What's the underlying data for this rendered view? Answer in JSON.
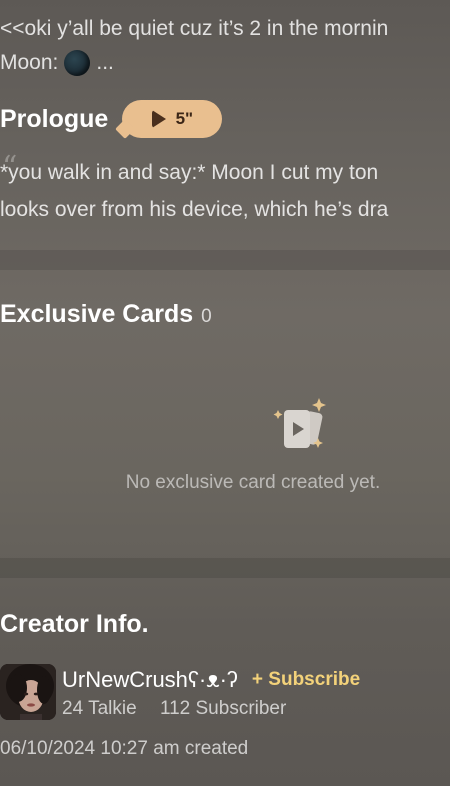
{
  "intro": {
    "line1": "<<oki y’all be quiet cuz it’s 2 in the mornin",
    "moon_speaker": "Moon:",
    "moon_tail": "...",
    "moon_emoji": "new-moon-emoji"
  },
  "prologue": {
    "title": "Prologue",
    "voice_duration": "5\"",
    "line1": "*you walk in and say:* Moon I cut my ton",
    "line2": "looks over from his device, which he’s dra"
  },
  "exclusive_cards": {
    "title": "Exclusive Cards",
    "count": "0",
    "empty_text": "No exclusive card created yet.",
    "empty_icon": "sparkle-cards-icon"
  },
  "creator": {
    "title": "Creator Info.",
    "name": "UrNewCrushʕ·ᴥ·ʔ",
    "subscribe_label": "+ Subscribe",
    "talkie_count": "24 Talkie",
    "subscriber_count": "112 Subscriber",
    "created": "06/10/2024 10:27 am created"
  },
  "colors": {
    "accent_subscribe": "#f3d27a",
    "voice_pill": "#e9bf8f",
    "sparkle": "#e4c48c"
  }
}
